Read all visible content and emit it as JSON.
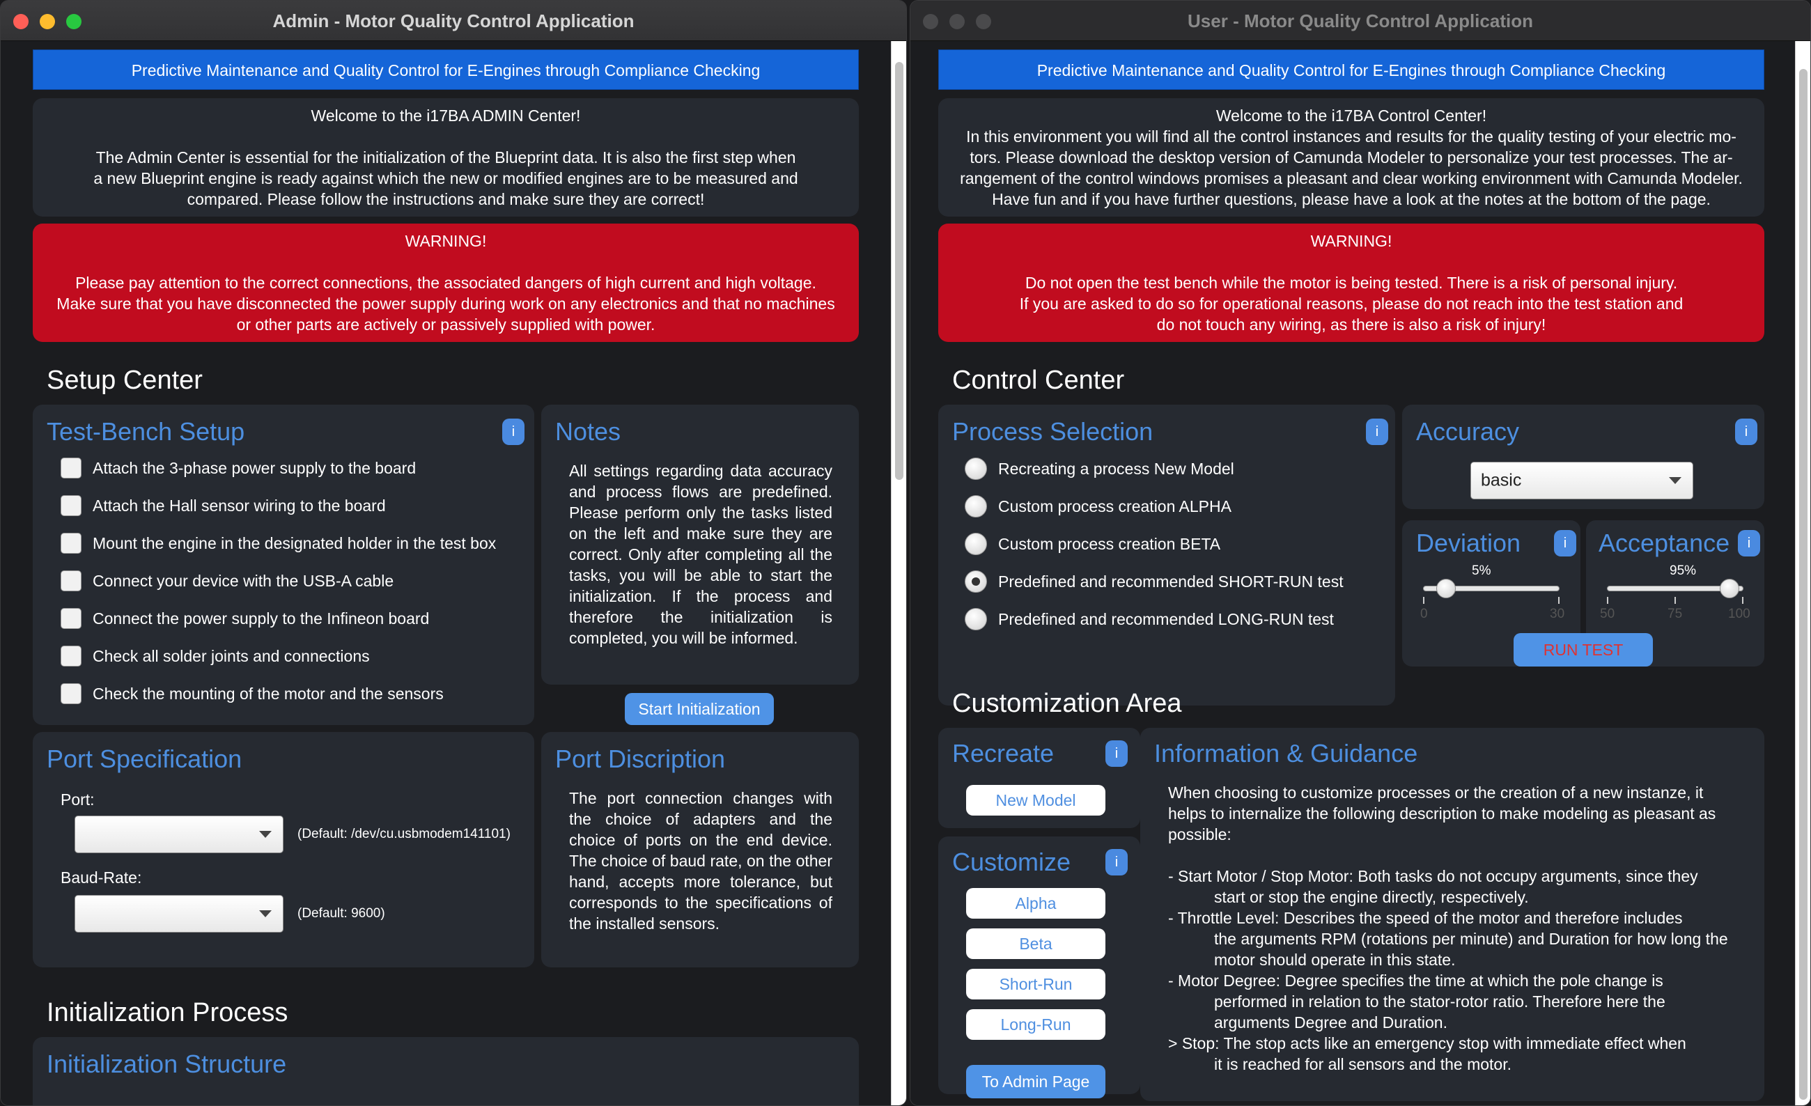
{
  "admin": {
    "window_title": "Admin - Motor Quality Control Application",
    "banner": "Predictive Maintenance and Quality Control for E-Engines through Compliance Checking",
    "welcome": "Welcome to the i17BA ADMIN Center!\n\nThe Admin Center is essential for the initialization of the Blueprint data. It is also the first step when\na new Blueprint engine is ready against which the new or modified engines are to be measured and\ncompared. Please follow the instructions and make sure they are correct!",
    "warning": "WARNING!\n\nPlease pay attention to the correct connections, the associated dangers of high current and high voltage.\nMake sure that you have disconnected the power supply during work on any electronics and that no machines\nor other  parts are actively or passively supplied with power.",
    "setup_center_title": "Setup Center",
    "testbench": {
      "title": "Test-Bench Setup",
      "info": "i",
      "items": [
        "Attach the 3-phase power supply to the board",
        "Attach the Hall sensor wiring to the board",
        "Mount the engine in the designated holder in the test box",
        "Connect your device with the USB-A cable",
        "Connect the power supply to the Infineon board",
        "Check all solder joints and connections",
        "Check the mounting of the motor and the sensors"
      ]
    },
    "notes": {
      "title": "Notes",
      "text": "All settings regarding data accuracy and process flows are predefined. Please perform only the tasks listed on the left and make sure they are correct. Only after completing all the tasks, you will be able to start the initialization. If the process and therefore the initialization is completed, you will be informed.",
      "button": "Start Initialization"
    },
    "port_spec": {
      "title": "Port Specification",
      "port_label": "Port:",
      "port_default": "(Default: /dev/cu.usbmodem141101)",
      "baud_label": "Baud-Rate:",
      "baud_default": "(Default: 9600)"
    },
    "port_desc": {
      "title": "Port Discription",
      "text": "The port connection changes with the choice of adapters and the choice of ports on the end device. The choice of baud rate, on the other hand, accepts more tolerance, but corresponds to the specifications of the installed sensors."
    },
    "init_process_title": "Initialization Process",
    "init_structure_title": "Initialization Structure"
  },
  "user": {
    "window_title": "User - Motor Quality Control Application",
    "banner": "Predictive Maintenance and Quality Control for E-Engines through Compliance Checking",
    "welcome": "Welcome to the i17BA Control Center!\nIn this environment you will find all the control instances and results for the quality testing of your electric mo-\ntors. Please download the desktop version of Camunda Modeler to personalize your test processes. The  ar-\nrangement of the control windows promises a pleasant and clear working environment with Camunda Modeler.\nHave fun and if you have further questions, please have a look at the notes at the bottom of the page.",
    "warning": "WARNING!\n\nDo not open the test bench while the motor is being tested. There is a risk of personal injury.\nIf you are asked to do so for operational reasons, please do not reach into the test station and\ndo not touch any wiring, as there is also a risk of injury!",
    "control_center_title": "Control Center",
    "process_selection": {
      "title": "Process Selection",
      "info": "i",
      "options": [
        "Recreating a process New Model",
        "Custom process creation ALPHA",
        "Custom process creation BETA",
        "Predefined and recommended SHORT-RUN test",
        "Predefined and recommended LONG-RUN test"
      ],
      "selected_index": 3
    },
    "accuracy": {
      "title": "Accuracy",
      "info": "i",
      "value": "basic"
    },
    "deviation": {
      "title": "Deviation",
      "info": "i",
      "value_label": "5%",
      "value": 5,
      "min": 0,
      "max": 30,
      "ticks": [
        "0",
        "30"
      ]
    },
    "acceptance": {
      "title": "Acceptance",
      "info": "i",
      "value_label": "95%",
      "value": 95,
      "min": 50,
      "max": 100,
      "ticks": [
        "50",
        "75",
        "100"
      ]
    },
    "run_test": "RUN TEST",
    "customization_title": "Customization Area",
    "recreate": {
      "title": "Recreate",
      "info": "i",
      "button": "New Model"
    },
    "customize": {
      "title": "Customize",
      "info": "i",
      "buttons": [
        "Alpha",
        "Beta",
        "Short-Run",
        "Long-Run"
      ]
    },
    "to_admin": "To Admin Page",
    "guidance": {
      "title": "Information & Guidance",
      "intro": "When choosing to customize processes or the creation of a new instanze, it helps to internalize the following description to make modeling as pleasant as possible:",
      "items": [
        {
          "head": "- Start Motor / Stop Motor:  Both tasks do not occupy arguments, since they",
          "rest": "start or stop the engine directly, respectively."
        },
        {
          "head": "- Throttle Level:  Describes the speed of the motor and therefore includes",
          "rest": "the arguments RPM (rotations per minute) and Duration for how long the motor should operate in this state."
        },
        {
          "head": "- Motor Degree:  Degree specifies the time at which the pole change is",
          "rest": "performed in relation to the stator-rotor ratio. Therefore here the arguments Degree and Duration."
        },
        {
          "head": "> Stop: The stop acts like an emergency stop with immediate effect when",
          "rest": "it is reached for all sensors and the motor."
        }
      ]
    }
  },
  "colors": {
    "accent": "#4d8fe0",
    "banner": "#1565d8",
    "warning": "#c10c1f",
    "panel": "#262a31"
  }
}
